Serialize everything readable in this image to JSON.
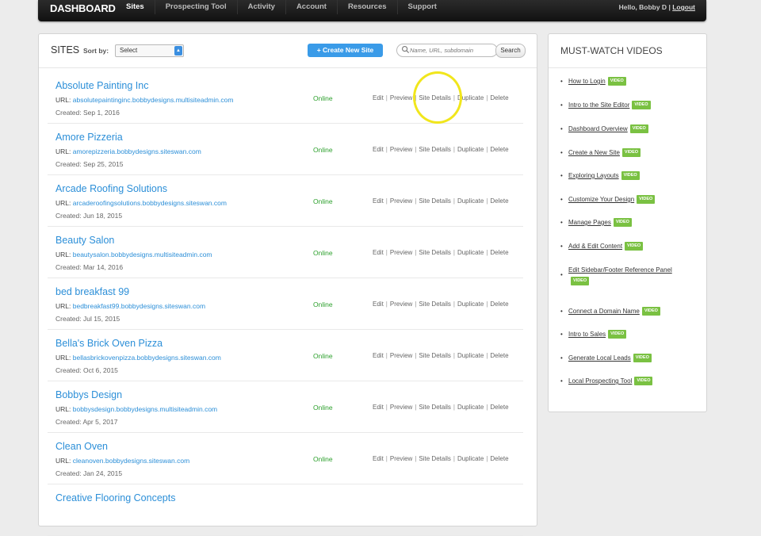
{
  "nav": {
    "brand": "DASHBOARD",
    "items": [
      {
        "label": "Sites",
        "active": true
      },
      {
        "label": "Prospecting Tool",
        "active": false
      },
      {
        "label": "Activity",
        "active": false
      },
      {
        "label": "Account",
        "active": false
      },
      {
        "label": "Resources",
        "active": false
      },
      {
        "label": "Support",
        "active": false
      }
    ],
    "greeting": "Hello, Bobby D",
    "separator": "|",
    "logout": "Logout"
  },
  "sites": {
    "title": "SITES",
    "sort_label": "Sort by:",
    "sort_value": "Select",
    "create_button": "+ Create New Site",
    "search_placeholder": "Name, URL, subdomain",
    "search_button": "Search",
    "url_prefix": "URL:",
    "action_separator": "|",
    "rows": [
      {
        "name": "Absolute Painting Inc",
        "url": "absolutepaintinginc.bobbydesigns.multisiteadmin.com",
        "created": "Created: Sep 1, 2016",
        "status": "Online",
        "actions": {
          "edit": "Edit",
          "preview": "Preview",
          "details": "Site Details",
          "duplicate": "Duplicate",
          "delete": "Delete"
        }
      },
      {
        "name": "Amore Pizzeria",
        "url": "amorepizzeria.bobbydesigns.siteswan.com",
        "created": "Created: Sep 25, 2015",
        "status": "Online",
        "actions": {
          "edit": "Edit",
          "preview": "Preview",
          "details": "Site Details",
          "duplicate": "Duplicate",
          "delete": "Delete"
        }
      },
      {
        "name": "Arcade Roofing Solutions",
        "url": "arcaderoofingsolutions.bobbydesigns.siteswan.com",
        "created": "Created: Jun 18, 2015",
        "status": "Online",
        "actions": {
          "edit": "Edit",
          "preview": "Preview",
          "details": "Site Details",
          "duplicate": "Duplicate",
          "delete": "Delete"
        }
      },
      {
        "name": "Beauty Salon",
        "url": "beautysalon.bobbydesigns.multisiteadmin.com",
        "created": "Created: Mar 14, 2016",
        "status": "Online",
        "actions": {
          "edit": "Edit",
          "preview": "Preview",
          "details": "Site Details",
          "duplicate": "Duplicate",
          "delete": "Delete"
        }
      },
      {
        "name": "bed breakfast 99",
        "url": "bedbreakfast99.bobbydesigns.siteswan.com",
        "created": "Created: Jul 15, 2015",
        "status": "Online",
        "actions": {
          "edit": "Edit",
          "preview": "Preview",
          "details": "Site Details",
          "duplicate": "Duplicate",
          "delete": "Delete"
        }
      },
      {
        "name": "Bella's Brick Oven Pizza",
        "url": "bellasbrickovenpizza.bobbydesigns.siteswan.com",
        "created": "Created: Oct 6, 2015",
        "status": "Online",
        "actions": {
          "edit": "Edit",
          "preview": "Preview",
          "details": "Site Details",
          "duplicate": "Duplicate",
          "delete": "Delete"
        }
      },
      {
        "name": "Bobbys Design",
        "url": "bobbysdesign.bobbydesigns.multisiteadmin.com",
        "created": "Created: Apr 5, 2017",
        "status": "Online",
        "actions": {
          "edit": "Edit",
          "preview": "Preview",
          "details": "Site Details",
          "duplicate": "Duplicate",
          "delete": "Delete"
        }
      },
      {
        "name": "Clean Oven",
        "url": "cleanoven.bobbydesigns.siteswan.com",
        "created": "Created: Jan 24, 2015",
        "status": "Online",
        "actions": {
          "edit": "Edit",
          "preview": "Preview",
          "details": "Site Details",
          "duplicate": "Duplicate",
          "delete": "Delete"
        }
      },
      {
        "name": "Creative Flooring Concepts",
        "url": "",
        "created": "",
        "status": "",
        "actions": {
          "edit": "",
          "preview": "",
          "details": "",
          "duplicate": "",
          "delete": ""
        }
      }
    ]
  },
  "videos": {
    "title": "MUST-WATCH VIDEOS",
    "badge": "VIDEO",
    "bullet": "•",
    "items": [
      "How to Login",
      "Intro to the Site Editor",
      "Dashboard Overview",
      "Create a New Site",
      "Exploring Layouts",
      "Customize Your Design",
      "Manage Pages",
      "Add & Edit Content",
      "Edit Sidebar/Footer Reference Panel",
      "Connect a Domain Name",
      "Intro to Sales",
      "Generate Local Leads",
      "Local Prospecting Tool"
    ]
  },
  "colors": {
    "link": "#2c8fd8",
    "online": "#2da02d",
    "create_button": "#3a9be8",
    "badge": "#7ac142",
    "highlight": "#f1e61c"
  }
}
